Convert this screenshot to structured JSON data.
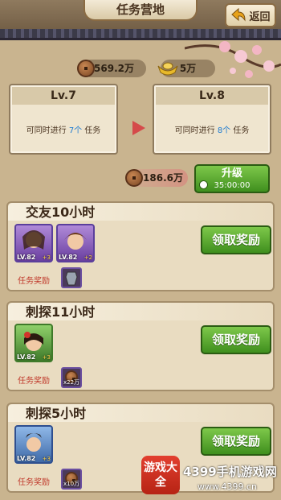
{
  "header": {
    "title": "任务营地",
    "back_label": "返回"
  },
  "currency": {
    "coins": "569.2万",
    "gold": "5万"
  },
  "levels": {
    "current": {
      "label": "Lv.7",
      "desc_pre": "可同时进行",
      "count": "7个",
      "desc_post": "任务"
    },
    "next": {
      "label": "Lv.8",
      "desc_pre": "可同时进行",
      "count": "8个",
      "desc_post": "任务"
    }
  },
  "upgrade": {
    "cost": "186.6万",
    "label": "升级",
    "time": "35:00:00"
  },
  "tasks": [
    {
      "title": "交友10小时",
      "heroes": [
        {
          "lv": "LV.82",
          "stars": "+3"
        },
        {
          "lv": "LV.82",
          "stars": "+2"
        }
      ],
      "reward_label": "任务奖励",
      "reward_qty": "",
      "claim_label": "领取奖励"
    },
    {
      "title": "刺探11小时",
      "heroes": [
        {
          "lv": "LV.82",
          "stars": "+3"
        }
      ],
      "reward_label": "任务奖励",
      "reward_qty": "x22万",
      "claim_label": "领取奖励"
    },
    {
      "title": "刺探5小时",
      "heroes": [
        {
          "lv": "LV.82",
          "stars": "+3"
        }
      ],
      "reward_label": "任务奖励",
      "reward_qty": "x10万",
      "claim_label": "领取奖励"
    }
  ],
  "watermark": {
    "badge": "游戏大全",
    "text": "4399手机游戏网",
    "url": "www.4399.cn"
  },
  "colors": {
    "accent_green": "#3f8f1e",
    "highlight_blue": "#1e7bd0",
    "reward_red": "#c0392b"
  }
}
